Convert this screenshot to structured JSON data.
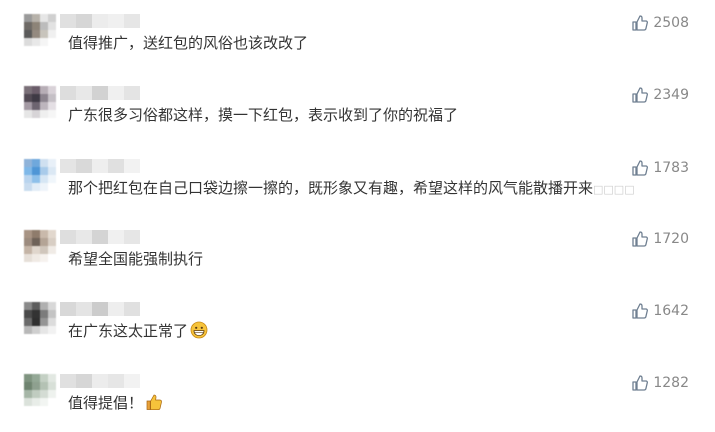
{
  "comments": [
    {
      "text": "值得推广，送红包的风俗也该改改了",
      "likes": "2508",
      "avatar_colors": [
        "#9a9a9a",
        "#b7b2aa",
        "#e6e6e6",
        "#d0d0d0",
        "#6e6a66",
        "#8d8478",
        "#bcbcbc",
        "#e2e2e2",
        "#5b5b5b",
        "#948a80",
        "#c8c4bc",
        "#f0f0f0",
        "#dcdcdc",
        "#e8e8e8",
        "#f5f5f5",
        "#ffffff"
      ],
      "name_colors": [
        "#e0e0e0",
        "#d6d6d6",
        "#ececec",
        "#f0f0f0",
        "#e6e6e6"
      ]
    },
    {
      "text": "广东很多习俗都这样，摸一下红包，表示收到了你的祝福了",
      "likes": "2349",
      "avatar_colors": [
        "#7a7078",
        "#6b5d6a",
        "#b7aeb6",
        "#d9d2d8",
        "#524a54",
        "#3f3a45",
        "#8c848e",
        "#c5c0c6",
        "#a49aa4",
        "#6d6470",
        "#bdb5bd",
        "#e4dfe4",
        "#e6e6e6",
        "#d7d4d7",
        "#efefef",
        "#f6f6f6"
      ],
      "name_colors": [
        "#dddddd",
        "#e8e8e8",
        "#d2d2d2",
        "#f0f0f0",
        "#e4e4e4"
      ]
    },
    {
      "text": "那个把红包在自己口袋边擦一擦的，既形象又有趣，希望这样的风气能散播开来",
      "suffix": "□□□□",
      "likes": "1783",
      "avatar_colors": [
        "#8fb3d9",
        "#6fa8dc",
        "#cfe0f0",
        "#e8f0f8",
        "#7fb8e8",
        "#4f96d6",
        "#a9cbea",
        "#dbe8f4",
        "#b9d4ee",
        "#8ec0ea",
        "#d6e6f4",
        "#f0f6fb",
        "#c9dcef",
        "#e2edf7",
        "#eef4fa",
        "#ffffff"
      ],
      "name_colors": [
        "#e4e4e4",
        "#d9d9d9",
        "#eeeeee",
        "#e0e0e0",
        "#f2f2f2"
      ]
    },
    {
      "text": "希望全国能强制执行",
      "likes": "1720",
      "avatar_colors": [
        "#a89484",
        "#8f7c6c",
        "#c9b9ab",
        "#e2d8ce",
        "#9c8b7e",
        "#6f6258",
        "#b4a496",
        "#d8cec4",
        "#c4b4a6",
        "#e0d6cc",
        "#d0c6bc",
        "#f0ebe6",
        "#e6dfd8",
        "#f0eae4",
        "#f6f2ee",
        "#ffffff"
      ],
      "name_colors": [
        "#dedede",
        "#e8e8e8",
        "#d4d4d4",
        "#f0f0f0",
        "#e6e6e6"
      ]
    },
    {
      "text": "在广东这太正常了",
      "emoji": "grin",
      "likes": "1642",
      "avatar_colors": [
        "#8a8a8a",
        "#5e5e5e",
        "#b0b0b0",
        "#d8d8d8",
        "#4a4a4a",
        "#333333",
        "#7c7c7c",
        "#c4c4c4",
        "#6a6a6a",
        "#2f2f2f",
        "#959595",
        "#dcdcdc",
        "#b8b8b8",
        "#cfcfcf",
        "#e6e6e6",
        "#f2f2f2"
      ],
      "name_colors": [
        "#d8d8d8",
        "#e4e4e4",
        "#cccccc",
        "#eeeeee",
        "#e0e0e0"
      ]
    },
    {
      "text": "值得提倡！",
      "emoji": "thumb",
      "likes": "1282",
      "avatar_colors": [
        "#7f9480",
        "#94a896",
        "#c4d0c4",
        "#e2e8e2",
        "#6f8470",
        "#8ea08f",
        "#b4c2b4",
        "#d8e0d8",
        "#a6b6a7",
        "#c0ccc0",
        "#d4dcd4",
        "#eef2ee",
        "#dbe2db",
        "#e8ede8",
        "#f2f5f2",
        "#ffffff"
      ],
      "name_colors": [
        "#e0e0e0",
        "#d6d6d6",
        "#ececec",
        "#e6e6e6",
        "#f2f2f2"
      ]
    }
  ],
  "icons": {
    "like": "thumbs-up-outline-icon",
    "grin": "grinning-face-emoji",
    "thumb": "thumbs-up-emoji"
  },
  "colors": {
    "text": "#333333",
    "likes": "#888888",
    "icon": "#6f7f91"
  }
}
